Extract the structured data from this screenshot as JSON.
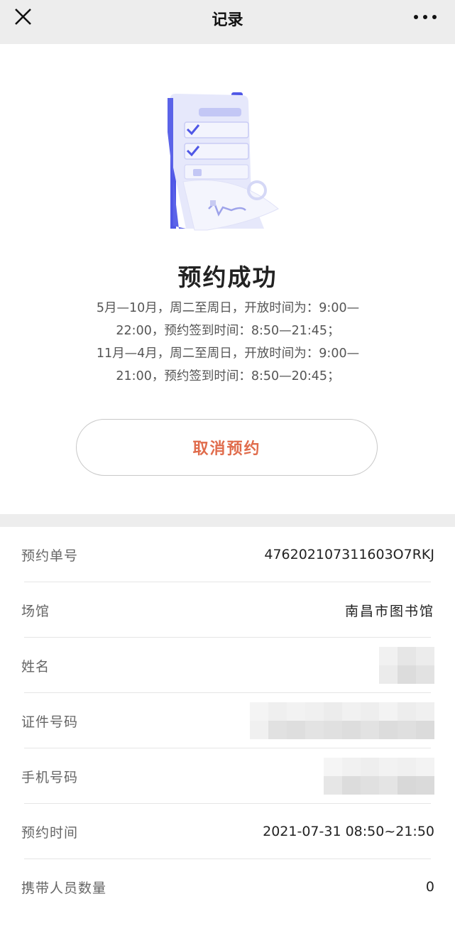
{
  "nav": {
    "title": "记录"
  },
  "success": {
    "headline": "预约成功",
    "notice_lines": [
      "5月—10月，周二至周日，开放时间为：9:00—",
      "22:00，预约签到时间：8:50—21:45；",
      "11月—4月，周二至周日，开放时间为：9:00—",
      "21:00，预约签到时间：8:50—20:45；"
    ],
    "cancel_label": "取消预约"
  },
  "details": {
    "order_no": {
      "label": "预约单号",
      "value": "476202107311603O7RKJ"
    },
    "venue": {
      "label": "场馆",
      "value": "南昌市图书馆"
    },
    "name": {
      "label": "姓名"
    },
    "id_number": {
      "label": "证件号码"
    },
    "phone": {
      "label": "手机号码"
    },
    "time": {
      "label": "预约时间",
      "value": "2021-07-31 08:50~21:50"
    },
    "companions": {
      "label": "携带人员数量",
      "value": "0"
    }
  },
  "colors": {
    "accent": "#e06c4c",
    "illustration": "#5b63e8",
    "nav_bg": "#ededed"
  }
}
